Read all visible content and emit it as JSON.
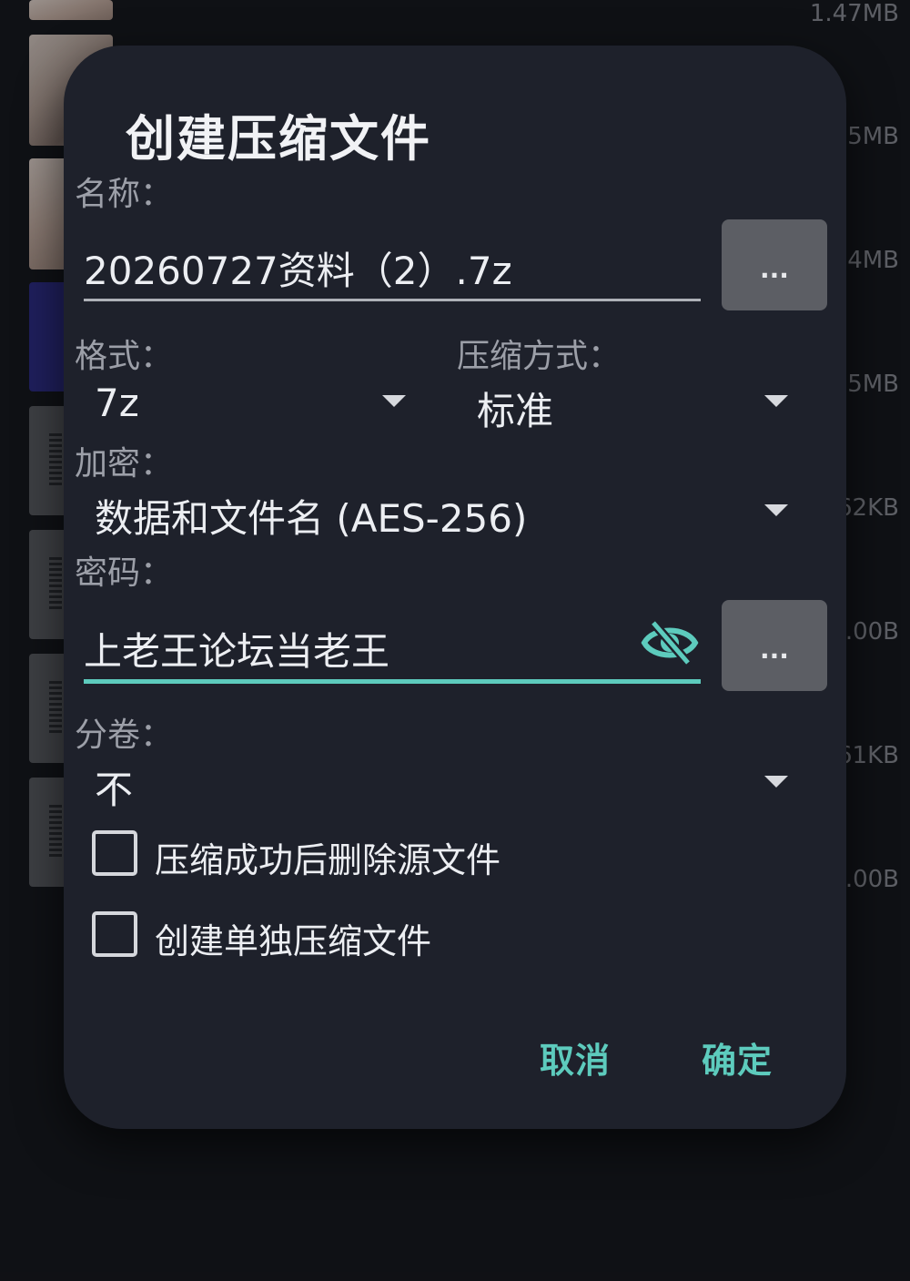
{
  "background": {
    "file_sizes": [
      "1.47MB",
      "5MB",
      "4MB",
      "5MB",
      "62KB",
      ".00B",
      "61KB",
      ".00B"
    ]
  },
  "dialog": {
    "title": "创建压缩文件",
    "name_label": "名称：",
    "name_value": "20260727资料（2）.7z",
    "more_button_label": "...",
    "format_label": "格式：",
    "format_value": "7z",
    "method_label": "压缩方式：",
    "method_value": "标准",
    "encryption_label": "加密：",
    "encryption_value": "数据和文件名 (AES-256)",
    "password_label": "密码：",
    "password_value": "上老王论坛当老王",
    "password_more_label": "...",
    "split_label": "分卷：",
    "split_value": "不",
    "checkbox_delete_label": "压缩成功后删除源文件",
    "checkbox_delete_checked": false,
    "checkbox_separate_label": "创建单独压缩文件",
    "checkbox_separate_checked": false,
    "cancel_label": "取消",
    "ok_label": "确定"
  },
  "colors": {
    "accent": "#5dcbbd",
    "dialog_bg": "#1e212b",
    "page_bg": "#131419"
  },
  "icons": {
    "password_toggle": "eye-slash-icon",
    "dropdown": "caret-down-icon"
  }
}
